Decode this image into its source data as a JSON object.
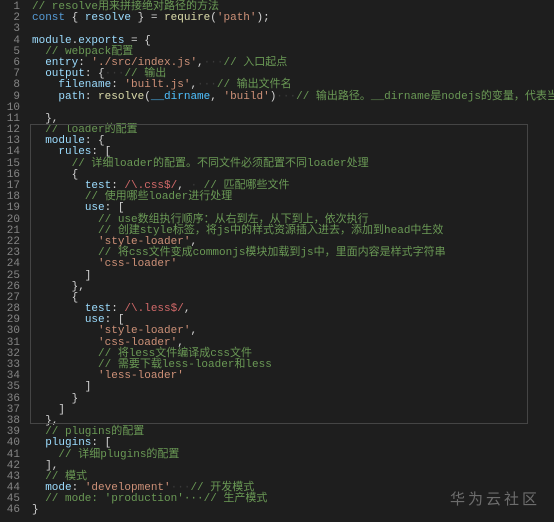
{
  "watermark": "华为云社区",
  "lines": [
    [
      [
        "c-comment",
        "// resolve用来拼接绝对路径的方法"
      ]
    ],
    [
      [
        "c-keyword",
        "const"
      ],
      [
        "c-punc",
        " { "
      ],
      [
        "c-id",
        "resolve"
      ],
      [
        "c-punc",
        " } = "
      ],
      [
        "c-func",
        "require"
      ],
      [
        "c-punc",
        "("
      ],
      [
        "c-string",
        "'path'"
      ],
      [
        "c-punc",
        ");"
      ]
    ],
    [],
    [
      [
        "c-prop",
        "module"
      ],
      [
        "c-punc",
        "."
      ],
      [
        "c-prop",
        "exports"
      ],
      [
        "c-punc",
        " = {"
      ]
    ],
    [
      [
        "c-punc",
        "  "
      ],
      [
        "c-comment",
        "// webpack配置"
      ]
    ],
    [
      [
        "c-punc",
        "  "
      ],
      [
        "c-prop",
        "entry"
      ],
      [
        "c-punc",
        ": "
      ],
      [
        "c-string",
        "'./src/index.js'"
      ],
      [
        "c-punc",
        ","
      ],
      [
        "ws",
        "···"
      ],
      [
        "c-comment",
        "// 入口起点"
      ]
    ],
    [
      [
        "c-punc",
        "  "
      ],
      [
        "c-prop",
        "output"
      ],
      [
        "c-punc",
        ": {"
      ],
      [
        "ws",
        "···"
      ],
      [
        "c-comment",
        "// 输出"
      ]
    ],
    [
      [
        "c-punc",
        "    "
      ],
      [
        "c-prop",
        "filename"
      ],
      [
        "c-punc",
        ": "
      ],
      [
        "c-string",
        "'built.js'"
      ],
      [
        "c-punc",
        ","
      ],
      [
        "ws",
        "···"
      ],
      [
        "c-comment",
        "// 输出文件名"
      ]
    ],
    [
      [
        "c-punc",
        "    "
      ],
      [
        "c-prop",
        "path"
      ],
      [
        "c-punc",
        ": "
      ],
      [
        "c-func",
        "resolve"
      ],
      [
        "c-punc",
        "("
      ],
      [
        "c-const",
        "__dirname"
      ],
      [
        "c-punc",
        ", "
      ],
      [
        "c-string",
        "'build'"
      ],
      [
        "c-punc",
        ")"
      ],
      [
        "ws",
        "···"
      ],
      [
        "c-comment",
        "// 输出路径。__dirname是nodejs的变量，代表当前文件的目录绝对路径"
      ]
    ],
    [],
    [
      [
        "c-punc",
        "  },"
      ]
    ],
    [
      [
        "c-punc",
        "  "
      ],
      [
        "c-comment",
        "// loader的配置"
      ]
    ],
    [
      [
        "c-punc",
        "  "
      ],
      [
        "c-prop",
        "module"
      ],
      [
        "c-punc",
        ": {"
      ]
    ],
    [
      [
        "c-punc",
        "    "
      ],
      [
        "c-prop",
        "rules"
      ],
      [
        "c-punc",
        ": ["
      ]
    ],
    [
      [
        "c-punc",
        "      "
      ],
      [
        "c-comment",
        "// 详细loader的配置。不同文件必须配置不同loader处理"
      ]
    ],
    [
      [
        "c-punc",
        "      {"
      ]
    ],
    [
      [
        "c-punc",
        "        "
      ],
      [
        "c-prop",
        "test"
      ],
      [
        "c-punc",
        ": "
      ],
      [
        "c-regex",
        "/\\.css$/"
      ],
      [
        "c-punc",
        ","
      ],
      [
        "ws",
        " · "
      ],
      [
        "c-comment",
        "// 匹配哪些文件"
      ]
    ],
    [
      [
        "c-punc",
        "        "
      ],
      [
        "c-comment",
        "// 使用哪些loader进行处理"
      ]
    ],
    [
      [
        "c-punc",
        "        "
      ],
      [
        "c-prop",
        "use"
      ],
      [
        "c-punc",
        ": ["
      ]
    ],
    [
      [
        "c-punc",
        "          "
      ],
      [
        "c-comment",
        "// use数组执行顺序：从右到左，从下到上，依次执行"
      ]
    ],
    [
      [
        "c-punc",
        "          "
      ],
      [
        "c-comment",
        "// 创建style标签，将js中的样式资源插入进去，添加到head中生效"
      ]
    ],
    [
      [
        "c-punc",
        "          "
      ],
      [
        "c-string",
        "'style-loader'"
      ],
      [
        "c-punc",
        ","
      ]
    ],
    [
      [
        "c-punc",
        "          "
      ],
      [
        "c-comment",
        "// 将css文件变成commonjs模块加载到js中，里面内容是样式字符串"
      ]
    ],
    [
      [
        "c-punc",
        "          "
      ],
      [
        "c-string",
        "'css-loader'"
      ]
    ],
    [
      [
        "c-punc",
        "        ]"
      ]
    ],
    [
      [
        "c-punc",
        "      },"
      ]
    ],
    [
      [
        "c-punc",
        "      {"
      ]
    ],
    [
      [
        "c-punc",
        "        "
      ],
      [
        "c-prop",
        "test"
      ],
      [
        "c-punc",
        ": "
      ],
      [
        "c-regex",
        "/\\.less$/"
      ],
      [
        "c-punc",
        ","
      ]
    ],
    [
      [
        "c-punc",
        "        "
      ],
      [
        "c-prop",
        "use"
      ],
      [
        "c-punc",
        ": ["
      ]
    ],
    [
      [
        "c-punc",
        "          "
      ],
      [
        "c-string",
        "'style-loader'"
      ],
      [
        "c-punc",
        ","
      ]
    ],
    [
      [
        "c-punc",
        "          "
      ],
      [
        "c-string",
        "'css-loader'"
      ],
      [
        "c-punc",
        ","
      ]
    ],
    [
      [
        "c-punc",
        "          "
      ],
      [
        "c-comment",
        "// 将less文件编译成css文件"
      ]
    ],
    [
      [
        "c-punc",
        "          "
      ],
      [
        "c-comment",
        "// 需要下载less-loader和less"
      ]
    ],
    [
      [
        "c-punc",
        "          "
      ],
      [
        "c-string",
        "'less-loader'"
      ]
    ],
    [
      [
        "c-punc",
        "        ]"
      ]
    ],
    [
      [
        "c-punc",
        "      }"
      ]
    ],
    [
      [
        "c-punc",
        "    ]"
      ]
    ],
    [
      [
        "c-punc",
        "  },"
      ]
    ],
    [
      [
        "c-punc",
        "  "
      ],
      [
        "c-comment",
        "// plugins的配置"
      ]
    ],
    [
      [
        "c-punc",
        "  "
      ],
      [
        "c-prop",
        "plugins"
      ],
      [
        "c-punc",
        ": ["
      ]
    ],
    [
      [
        "c-punc",
        "    "
      ],
      [
        "c-comment",
        "// 详细plugins的配置"
      ]
    ],
    [
      [
        "c-punc",
        "  ],"
      ]
    ],
    [
      [
        "c-punc",
        "  "
      ],
      [
        "c-comment",
        "// 模式"
      ]
    ],
    [
      [
        "c-punc",
        "  "
      ],
      [
        "c-prop",
        "mode"
      ],
      [
        "c-punc",
        ": "
      ],
      [
        "c-string",
        "'development'"
      ],
      [
        "ws",
        "···"
      ],
      [
        "c-comment",
        "// 开发模式"
      ]
    ],
    [
      [
        "c-punc",
        "  "
      ],
      [
        "c-comment",
        "// mode: 'production'···// 生产模式"
      ]
    ],
    [
      [
        "c-punc",
        "}"
      ]
    ]
  ]
}
